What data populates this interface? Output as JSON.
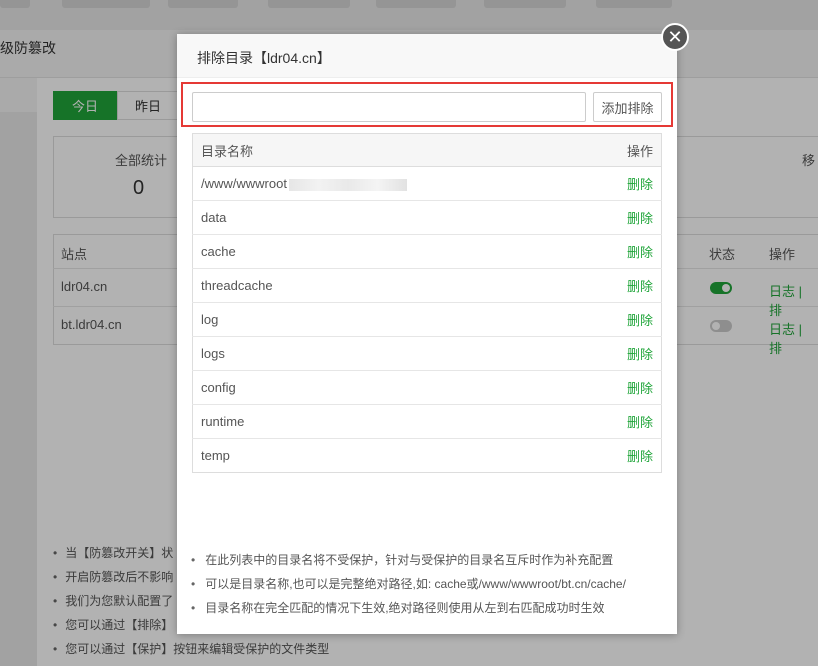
{
  "background": {
    "page_title": "级防篡改",
    "tabs": [
      "今日",
      "昨日"
    ],
    "stat_label": "全部统计",
    "stat_value": "0",
    "stat_right_label": "移",
    "table": {
      "headers": {
        "site": "站点",
        "status": "状态",
        "action": "操作"
      },
      "rows": [
        {
          "site": "ldr04.cn",
          "status_on": true,
          "action": "日志 | 排"
        },
        {
          "site": "bt.ldr04.cn",
          "status_on": false,
          "action": "日志 | 排"
        }
      ]
    },
    "notes": [
      "当【防篡改开关】状",
      "开启防篡改后不影响",
      "我们为您默认配置了",
      "您可以通过【排除】",
      "您可以通过【保护】按钮来编辑受保护的文件类型"
    ]
  },
  "modal": {
    "title": "排除目录【ldr04.cn】",
    "close_symbol": "✕",
    "input": {
      "value": "",
      "placeholder": ""
    },
    "add_button": "添加排除",
    "table": {
      "header_name": "目录名称",
      "header_action": "操作",
      "delete_label": "删除",
      "rows": [
        "/www/wwwroot",
        "data",
        "cache",
        "threadcache",
        "log",
        "logs",
        "config",
        "runtime",
        "temp"
      ]
    },
    "tips": [
      "在此列表中的目录名将不受保护，针对与受保护的目录名互斥时作为补充配置",
      "可以是目录名称,也可以是完整绝对路径,如: cache或/www/wwwroot/bt.cn/cache/",
      "目录名称在完全匹配的情况下生效,绝对路径则使用从左到右匹配成功时生效"
    ]
  },
  "colors": {
    "accent": "#20a53a",
    "highlight_border": "#e53935"
  }
}
